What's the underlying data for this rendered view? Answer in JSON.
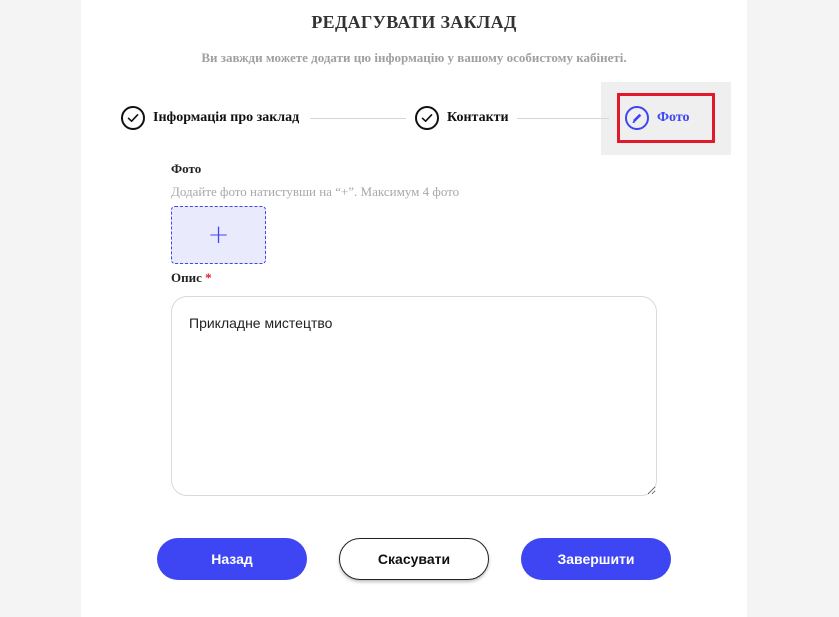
{
  "header": {
    "title": "РЕДАГУВАТИ ЗАКЛАД",
    "subtitle": "Ви завжди можете додати цю інформацію у вашому особистому кабінеті."
  },
  "stepper": {
    "steps": [
      {
        "label": "Інформація про заклад",
        "status": "done",
        "icon": "check-icon"
      },
      {
        "label": "Контакти",
        "status": "done",
        "icon": "check-icon"
      },
      {
        "label": "Фото",
        "status": "active",
        "icon": "pencil-icon"
      }
    ]
  },
  "photo": {
    "label": "Фото",
    "hint": "Додайте фото натистувши на “+”. Максимум 4 фото",
    "add_symbol": "+"
  },
  "description": {
    "label": "Опис",
    "required_mark": "*",
    "value": "Прикладне мистецтво"
  },
  "actions": {
    "back_label": "Назад",
    "cancel_label": "Скасувати",
    "finish_label": "Завершити"
  },
  "colors": {
    "accent": "#3d46f2",
    "highlight": "#e3192b"
  }
}
